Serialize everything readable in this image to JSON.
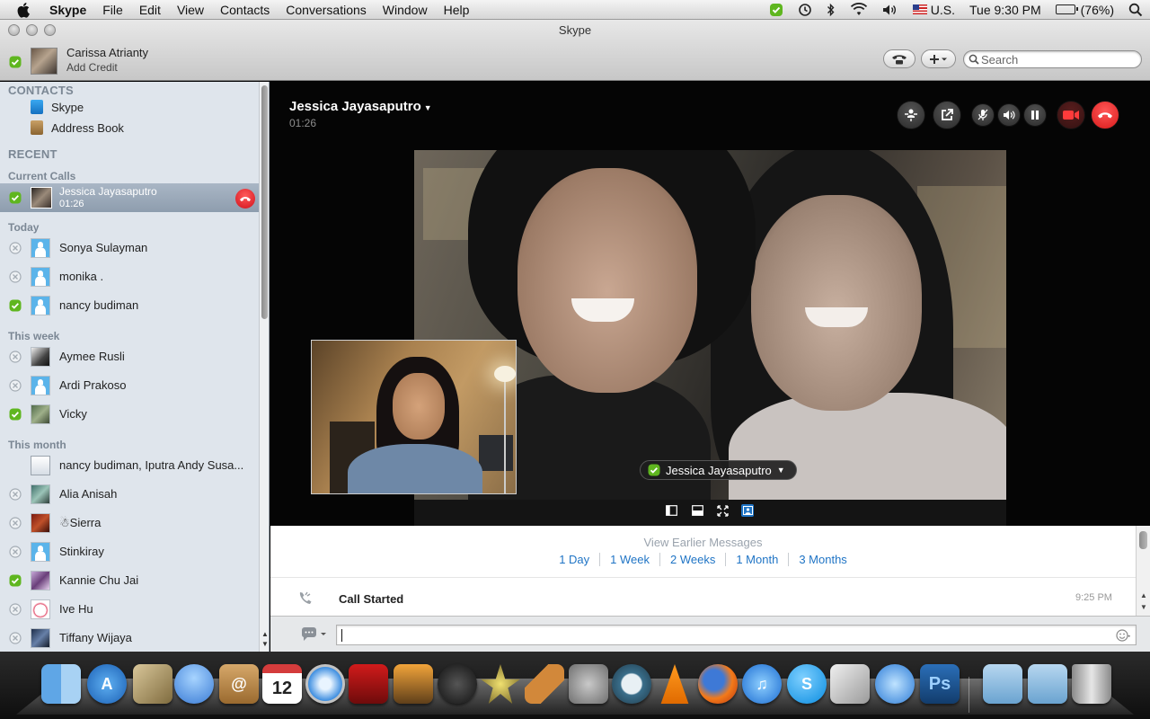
{
  "menubar": {
    "app": "Skype",
    "items": [
      "File",
      "Edit",
      "View",
      "Contacts",
      "Conversations",
      "Window",
      "Help"
    ],
    "input_source": "U.S.",
    "clock": "Tue 9:30 PM",
    "battery": "(76%)",
    "battery_level": 0.76
  },
  "window": {
    "title": "Skype"
  },
  "account": {
    "name": "Carissa Atrianty",
    "credit_label": "Add Credit"
  },
  "search": {
    "placeholder": "Search"
  },
  "sidebar": {
    "contacts_header": "CONTACTS",
    "nav": [
      {
        "label": "Skype",
        "icon": "skype-app-icon"
      },
      {
        "label": "Address Book",
        "icon": "address-book-icon"
      }
    ],
    "recent_header": "RECENT",
    "current_calls_header": "Current Calls",
    "current_call": {
      "name": "Jessica Jayasaputro",
      "duration": "01:26"
    },
    "groups": [
      {
        "title": "Today",
        "items": [
          {
            "name": "Sonya Sulayman",
            "status": "offline"
          },
          {
            "name": "monika .",
            "status": "offline"
          },
          {
            "name": "nancy budiman",
            "status": "online"
          }
        ]
      },
      {
        "title": "This week",
        "items": [
          {
            "name": "Aymee Rusli",
            "status": "offline"
          },
          {
            "name": "Ardi  Prakoso",
            "status": "offline"
          },
          {
            "name": "Vicky",
            "status": "online"
          }
        ]
      },
      {
        "title": "This month",
        "items": [
          {
            "name": "nancy budiman, Iputra Andy Susa...",
            "status": "group"
          },
          {
            "name": "Alia Anisah",
            "status": "offline"
          },
          {
            "name": "☃Sierra",
            "status": "offline"
          },
          {
            "name": "Stinkiray",
            "status": "offline"
          },
          {
            "name": "Kannie Chu Jai",
            "status": "online"
          },
          {
            "name": "Ive Hu",
            "status": "offline"
          },
          {
            "name": "Tiffany Wijaya",
            "status": "offline"
          }
        ]
      }
    ]
  },
  "call": {
    "contact": "Jessica Jayasaputro",
    "duration": "01:26",
    "video_label": "Jessica Jayasaputro"
  },
  "chat": {
    "view_earlier": "View Earlier Messages",
    "ranges": [
      "1 Day",
      "1 Week",
      "2 Weeks",
      "1 Month",
      "3 Months"
    ],
    "events": [
      {
        "text": "Call Started",
        "time": "9:25 PM"
      }
    ],
    "composer_value": ""
  },
  "colors": {
    "status_online": "#5fb61f",
    "link_blue": "#1f74c5",
    "hangup_red": "#d81a1a",
    "sidebar_bg": "#dfe5ec"
  },
  "dock": {
    "apps": [
      "finder-icon",
      "app-store-icon",
      "mail-stamp-icon",
      "ichat-icon",
      "address-book-icon",
      "ical-icon",
      "safari-icon",
      "photo-booth-icon",
      "iphoto-icon",
      "dashboard-icon",
      "imovie-icon",
      "garageband-icon",
      "system-preferences-icon",
      "time-machine-icon",
      "vlc-icon",
      "firefox-icon",
      "itunes-icon",
      "skype-icon",
      "preview-icon",
      "openoffice-icon",
      "photoshop-icon"
    ],
    "ical_day": "12",
    "stacks": [
      "applications-folder-icon",
      "documents-folder-icon",
      "trash-icon"
    ]
  }
}
